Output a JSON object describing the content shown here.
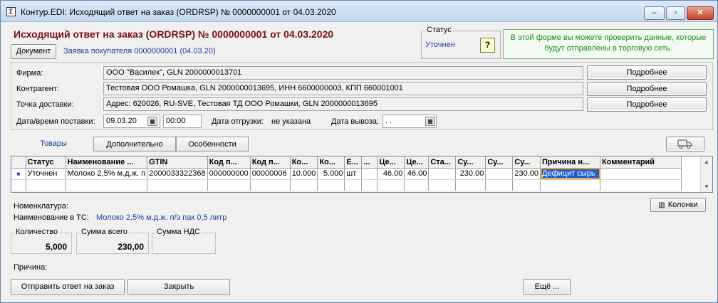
{
  "window": {
    "title": "Контур.EDI: Исходящий ответ на заказ (ORDRSP) № 0000000001 от 04.03.2020",
    "app_icon": "Σ",
    "minimize": "–",
    "maximize": "▫",
    "close": "✕"
  },
  "header": {
    "heading": "Исходящий ответ на заказ (ORDRSP) № 0000000001 от 04.03.2020",
    "document_button": "Документ",
    "order_link": "Заявка покупателя 0000000001 (04.03.20)",
    "status_legend": "Статус",
    "status_value": "Уточнен",
    "help_label": "?",
    "info_line1": "В этой форме вы можете проверить данные, которые",
    "info_line2": "будут отправлены в торговую сеть."
  },
  "details": {
    "firm_label": "Фирма:",
    "firm_value": "ООО \"Василек\", GLN 2000000013701",
    "contractor_label": "Контрагент:",
    "contractor_value": "Тестовая ООО Ромашка, GLN 2000000013695, ИНН 6600000003, КПП 660001001",
    "delivery_point_label": "Точка доставки:",
    "delivery_point_value": "Адрес: 620026, RU-SVE, Тестовая ТД ООО Ромашки, GLN 2000000013695",
    "more_label": "Подробнее",
    "delivery_datetime_label": "Дата/время поставки:",
    "delivery_date": "09.03.20",
    "delivery_time": "00:00",
    "shipment_date_label": "Дата отгрузки:",
    "shipment_date_value": "не указана",
    "export_date_label": "Дата вывоза:",
    "export_date_value": " .  ."
  },
  "tabs": {
    "goods": "Товары",
    "additional": "Дополнительно",
    "features": "Особенности"
  },
  "grid": {
    "columns": [
      "",
      "Статус",
      "Наименование ...",
      "GTIN",
      "Код п...",
      "Код п...",
      "Ко...",
      "Ко...",
      "Е...",
      "...",
      "Це...",
      "Це...",
      "Ста...",
      "Су...",
      "Су...",
      "Су...",
      "Причина н...",
      "Комментарий"
    ],
    "row": {
      "marker": "■",
      "status": "Уточнен",
      "name": "Молоко 2,5% м.д.ж. п",
      "gtin": "2000033322368",
      "code1": "000000000",
      "code2": "00000006",
      "qty1": "10.000",
      "qty2": "5.000",
      "unit": "шт",
      "blank1": "",
      "price1": "46.00",
      "price2": "46.00",
      "rate": "",
      "sum1": "230.00",
      "sum2": "",
      "sum3": "230.00",
      "reason": "Дефицит сырь",
      "comment": ""
    }
  },
  "bottom": {
    "nomenclature_label": "Номенклатура:",
    "ts_name_label": "Наименование в ТС:",
    "ts_name_value": "Молоко 2,5% м.д.ж. п/э пак 0,5 литр",
    "columns_button": "Колонки",
    "qty_legend": "Количество",
    "qty_value": "5,000",
    "total_legend": "Сумма всего",
    "total_value": "230,00",
    "vat_legend": "Сумма НДС",
    "vat_value": "",
    "reason_label": "Причина:",
    "send_button": "Отправить ответ на заказ",
    "close_button": "Закрыть",
    "more_button": "Ещё ..."
  },
  "colors": {
    "heading": "#7a1010",
    "link": "#1a3fa0",
    "info_text": "#1d8a1d",
    "selection": "#1d5fd1",
    "selection_border": "#f0a020"
  }
}
